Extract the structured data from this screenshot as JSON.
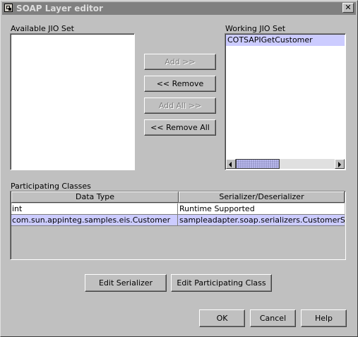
{
  "window": {
    "title": "SOAP Layer editor",
    "close_glyph": "✕",
    "app_icon": "window-icon"
  },
  "available": {
    "label": "Available JIO Set",
    "items": []
  },
  "working": {
    "label": "Working JIO Set",
    "items": [
      "COTSAPIGetCustomer"
    ]
  },
  "buttons": {
    "add": "Add >>",
    "remove": "<< Remove",
    "add_all": "Add All >>",
    "remove_all": "<< Remove All",
    "edit_serializer": "Edit Serializer",
    "edit_participating": "Edit Participating Class",
    "ok": "OK",
    "cancel": "Cancel",
    "help": "Help"
  },
  "classes": {
    "label": "Participating Classes",
    "columns": [
      "Data Type",
      "Serializer/Deserializer"
    ],
    "rows": [
      [
        "int",
        "Runtime Supported"
      ],
      [
        "com.sun.appinteg.samples.eis.Customer",
        "sampleadapter.soap.serializers.CustomerSeri..."
      ]
    ]
  },
  "colors": {
    "selection": "#ccccff",
    "titlebar": "#808080",
    "face": "#c0c0c0"
  }
}
